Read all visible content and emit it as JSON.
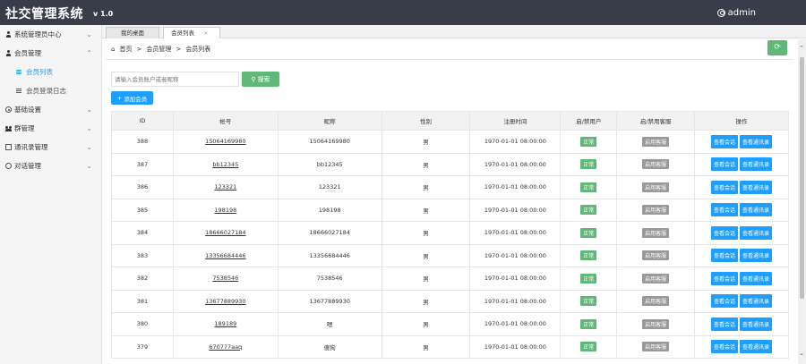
{
  "header": {
    "title": "社交管理系统",
    "version": "v 1.0",
    "user": "admin"
  },
  "sidebar": {
    "items": [
      {
        "label": "系统管理员中心",
        "icon": "person-icon"
      },
      {
        "label": "会员管理",
        "icon": "person-icon",
        "children": [
          {
            "label": "会员列表",
            "active": true
          },
          {
            "label": "会员登录日志",
            "active": false
          }
        ]
      },
      {
        "label": "基础设置",
        "icon": "gear-icon"
      },
      {
        "label": "群管理",
        "icon": "group-icon"
      },
      {
        "label": "通讯录管理",
        "icon": "book-icon"
      },
      {
        "label": "对话管理",
        "icon": "chat-icon"
      }
    ]
  },
  "tabs": [
    {
      "label": "我的桌面"
    },
    {
      "label": "会员列表",
      "close": "×"
    }
  ],
  "breadcrumb": {
    "home": "首页",
    "sep": ">",
    "level1": "会员管理",
    "level2": "会员列表"
  },
  "toolbar": {
    "search_placeholder": "请输入会员账户或者昵称",
    "search_label": "搜索",
    "add_label": "添加会员"
  },
  "table": {
    "headers": [
      "ID",
      "帐号",
      "昵称",
      "性别",
      "注册时间",
      "启/禁用户",
      "启/禁用客服",
      "操作"
    ],
    "status_label": "正常",
    "cs_label": "启用客服",
    "op1_label": "查看会话",
    "op2_label": "查看通讯录",
    "rows": [
      {
        "id": "388",
        "account": "15064169980",
        "nickname": "15064169980",
        "gender": "男",
        "reg_time": "1970-01-01 08:00:00"
      },
      {
        "id": "387",
        "account": "bb12345",
        "nickname": "bb12345",
        "gender": "男",
        "reg_time": "1970-01-01 08:00:00"
      },
      {
        "id": "386",
        "account": "123321",
        "nickname": "123321",
        "gender": "男",
        "reg_time": "1970-01-01 08:00:00"
      },
      {
        "id": "385",
        "account": "198198",
        "nickname": "198198",
        "gender": "男",
        "reg_time": "1970-01-01 08:00:00"
      },
      {
        "id": "384",
        "account": "18666027184",
        "nickname": "18666027184",
        "gender": "男",
        "reg_time": "1970-01-01 08:00:00"
      },
      {
        "id": "383",
        "account": "13356684446",
        "nickname": "13356684446",
        "gender": "男",
        "reg_time": "1970-01-01 08:00:00"
      },
      {
        "id": "382",
        "account": "7538546",
        "nickname": "7538546",
        "gender": "男",
        "reg_time": "1970-01-01 08:00:00"
      },
      {
        "id": "381",
        "account": "13677889930",
        "nickname": "13677889930",
        "gender": "男",
        "reg_time": "1970-01-01 08:00:00"
      },
      {
        "id": "380",
        "account": "189189",
        "nickname": "嗯",
        "gender": "男",
        "reg_time": "1970-01-01 08:00:00"
      },
      {
        "id": "379",
        "account": "670777aaq",
        "nickname": "傻狗",
        "gender": "男",
        "reg_time": "1970-01-01 08:00:00"
      }
    ]
  },
  "colors": {
    "topbar": "#393D49",
    "green": "#5FB878",
    "blue": "#1E9FFF",
    "gray": "#999999"
  }
}
